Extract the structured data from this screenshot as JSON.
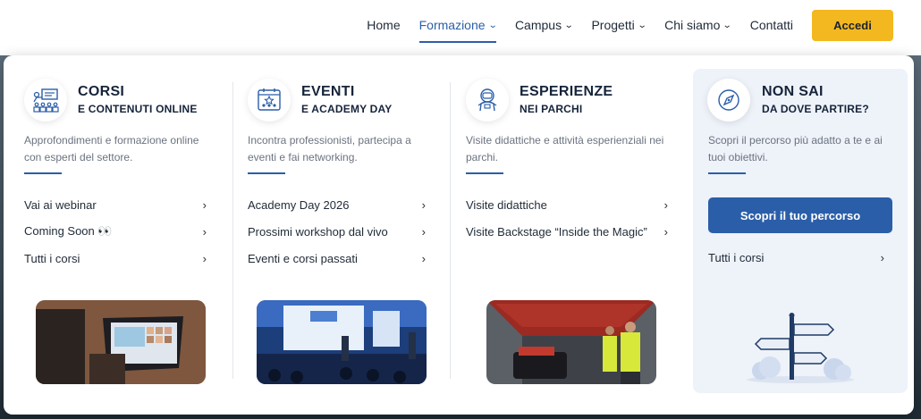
{
  "nav": {
    "items": [
      {
        "label": "Home",
        "dropdown": false,
        "active": false
      },
      {
        "label": "Formazione",
        "dropdown": true,
        "active": true
      },
      {
        "label": "Campus",
        "dropdown": true,
        "active": false
      },
      {
        "label": "Progetti",
        "dropdown": true,
        "active": false
      },
      {
        "label": "Chi siamo",
        "dropdown": true,
        "active": false
      },
      {
        "label": "Contatti",
        "dropdown": false,
        "active": false
      }
    ],
    "login_label": "Accedi"
  },
  "columns": [
    {
      "title": "CORSI",
      "subtitle": "E CONTENUTI ONLINE",
      "icon": "classroom-icon",
      "description": "Approfondimenti e formazione online con esperti del settore.",
      "links": [
        "Vai ai webinar",
        "Coming Soon 👀",
        "Tutti i corsi"
      ]
    },
    {
      "title": "EVENTI",
      "subtitle": "E ACADEMY DAY",
      "icon": "event-icon",
      "description": "Incontra professionisti, partecipa a eventi e fai networking.",
      "links": [
        "Academy Day 2026",
        "Prossimi workshop dal vivo",
        "Eventi e corsi passati"
      ]
    },
    {
      "title": "ESPERIENZE",
      "subtitle": "NEI PARCHI",
      "icon": "astronaut-icon",
      "description": "Visite didattiche e attività esperienziali nei parchi.",
      "links": [
        "Visite didattiche",
        "Visite Backstage “Inside the Magic”"
      ]
    },
    {
      "title": "NON SAI",
      "subtitle": "DA DOVE PARTIRE?",
      "icon": "compass-icon",
      "description": "Scopri il percorso più adatto a te e ai tuoi obiettivi.",
      "button_label": "Scopri il tuo percorso",
      "links": [
        "Tutti i corsi"
      ]
    }
  ],
  "colors": {
    "accent": "#2b5ea8",
    "login": "#f3b81f",
    "panel_tint": "#eef2f9"
  }
}
